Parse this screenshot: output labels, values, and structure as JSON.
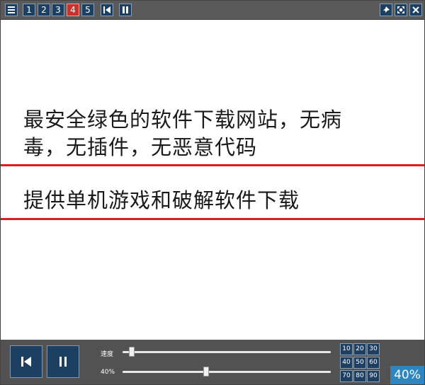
{
  "toolbar": {
    "menu_icon": "hamburger-menu-icon",
    "pages": [
      "1",
      "2",
      "3",
      "4",
      "5"
    ],
    "active_page": "4",
    "left_controls": [
      "skip-to-start-icon",
      "pause-icon"
    ],
    "right_controls": [
      "pin-icon",
      "fullscreen-icon",
      "close-icon"
    ]
  },
  "content": {
    "line1": "最安全绿色的软件下载网站，无病",
    "line2": "毒，无插件，无恶意代码",
    "line3": "提供单机游戏和破解软件下载",
    "rule_color": "#d81e1e"
  },
  "controls": {
    "speed_label": "速度",
    "speed_level": 0.03,
    "size_label": "40%",
    "size_level": 0.4,
    "presets": [
      "10",
      "20",
      "30",
      "40",
      "50",
      "60",
      "70",
      "80",
      "90"
    ],
    "percent_display": "40%"
  },
  "colors": {
    "toolbar_bg": "#5a5a5a",
    "button_bg": "#1d3f62",
    "active_button": "#c8312c",
    "panel_bg": "#525252",
    "percent_badge": "#2e86c1"
  }
}
